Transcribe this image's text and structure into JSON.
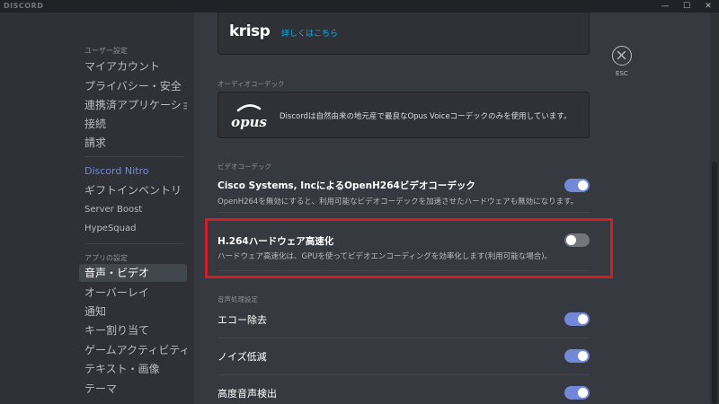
{
  "window": {
    "brand": "DISCORD",
    "controls": {
      "minimize": "—",
      "maximize": "☐",
      "close": "✕"
    }
  },
  "sidebar": {
    "user_settings_header": "ユーザー設定",
    "user_items": [
      {
        "label": "マイアカウント"
      },
      {
        "label": "プライバシー・安全"
      },
      {
        "label": "連携済アプリケーション"
      },
      {
        "label": "接続"
      },
      {
        "label": "請求"
      }
    ],
    "nitro_items": [
      {
        "label": "Discord Nitro"
      },
      {
        "label": "ギフトインベントリ"
      },
      {
        "label": "Server Boost"
      },
      {
        "label": "HypeSquad"
      }
    ],
    "app_settings_header": "アプリの設定",
    "app_items": [
      {
        "label": "音声・ビデオ",
        "active": true
      },
      {
        "label": "オーバーレイ"
      },
      {
        "label": "通知"
      },
      {
        "label": "キー割り当て"
      },
      {
        "label": "ゲームアクティビティ"
      },
      {
        "label": "テキスト・画像"
      },
      {
        "label": "テーマ"
      }
    ]
  },
  "content": {
    "krisp": {
      "logo": "krisp",
      "link": "詳しくはこちら"
    },
    "audio_codec": {
      "header": "オーディオコーデック",
      "logo": "opus",
      "text": "Discordは自然由来の地元産で最良なOpus Voiceコーデックのみを使用しています。"
    },
    "video_codec": {
      "header": "ビデオコーデック",
      "openh264": {
        "title": "Cisco Systems, IncによるOpenH264ビデオコーデック",
        "desc": "OpenH264を無効にすると、利用可能なビデオコーデックを加速させたハードウェアも無効になります。",
        "enabled": true
      },
      "hw_accel": {
        "title": "H.264ハードウェア高速化",
        "desc": "ハードウェア高速化は、GPUを使ってビデオエンコーディングを効率化します(利用可能な場合)。",
        "enabled": false
      }
    },
    "voice_processing": {
      "header": "音声処理設定",
      "echo": {
        "title": "エコー除去",
        "enabled": true
      },
      "noise": {
        "title": "ノイズ低減",
        "enabled": true
      },
      "advanced": {
        "title": "高度音声検出",
        "enabled": true
      }
    },
    "esc": {
      "label": "ESC"
    }
  },
  "colors": {
    "accent": "#7289da",
    "highlight": "#d01f26",
    "toggle_off": "#72767d",
    "link": "#00b0f4"
  }
}
